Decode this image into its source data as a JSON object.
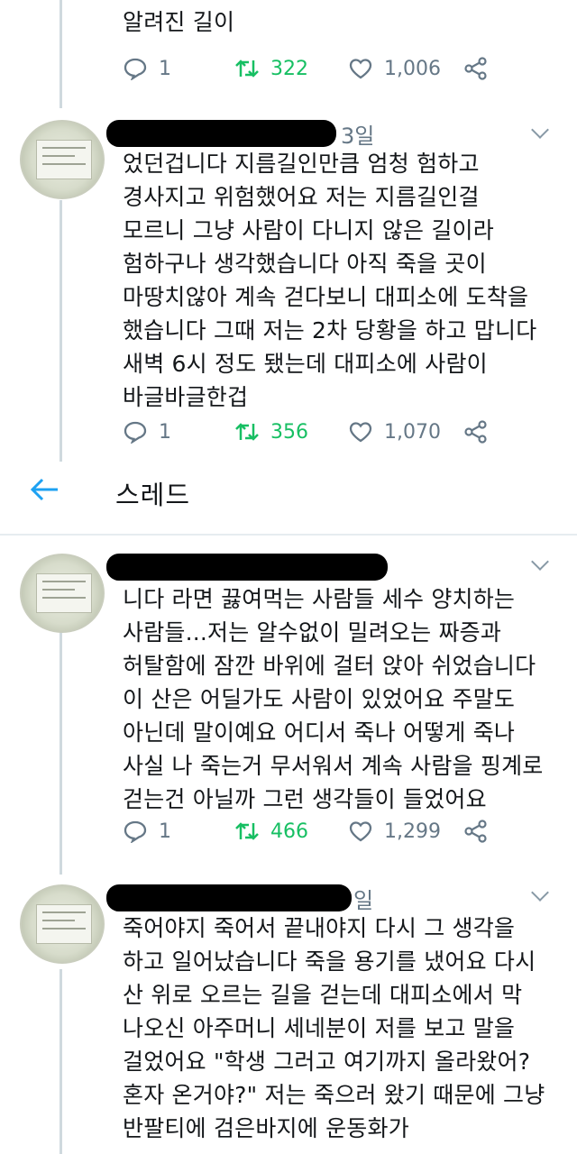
{
  "tweets": [
    {
      "text": "알려진 길이",
      "actions": {
        "replies": "1",
        "retweets": "322",
        "likes": "1,006"
      }
    },
    {
      "timestamp": "3일",
      "text": "었던겁니다 지름길인만큼 엄청 험하고\n경사지고 위험했어요 저는 지름길인걸\n모르니 그냥 사람이 다니지 않은 길이라\n험하구나 생각했습니다 아직 죽을 곳이\n마땅치않아 계속 걷다보니 대피소에 도착을\n했습니다 그때 저는 2차 당황을 하고 맙니다\n새벽 6시 정도 됐는데 대피소에 사람이\n바글바글한겁",
      "actions": {
        "replies": "1",
        "retweets": "356",
        "likes": "1,070"
      }
    },
    {
      "text": "니다 라면 끓여먹는 사람들 세수 양치하는\n사람들...저는 알수없이 밀려오는 짜증과\n허탈함에 잠깐 바위에 걸터 앉아 쉬었습니다\n이 산은 어딜가도 사람이 있었어요 주말도\n아닌데 말이예요 어디서 죽나 어떻게 죽나\n사실 나 죽는거 무서워서 계속 사람을 핑계로\n걷는건 아닐까 그런 생각들이 들었어요",
      "actions": {
        "replies": "1",
        "retweets": "466",
        "likes": "1,299"
      }
    },
    {
      "timestamp": "일",
      "text": "죽어야지 죽어서 끝내야지 다시 그 생각을\n하고 일어났습니다 죽을 용기를 냈어요 다시\n산 위로 오르는 길을 걷는데 대피소에서 막\n나오신 아주머니 세네분이 저를 보고 말을\n걸었어요 \"학생 그러고 여기까지 올라왔어?\n혼자 온거야?\" 저는 죽으러 왔기 때문에 그냥\n반팔티에 검은바지에 운동화가"
    }
  ],
  "header": {
    "title": "스레드",
    "back_icon": "arrow-left-icon"
  },
  "icons": {
    "reply": "reply-icon",
    "retweet": "retweet-icon",
    "like": "heart-icon",
    "share": "share-icon",
    "more": "chevron-down-icon"
  },
  "colors": {
    "accent": "#1da1f2",
    "retweet": "#17bf63",
    "muted": "#657786"
  }
}
